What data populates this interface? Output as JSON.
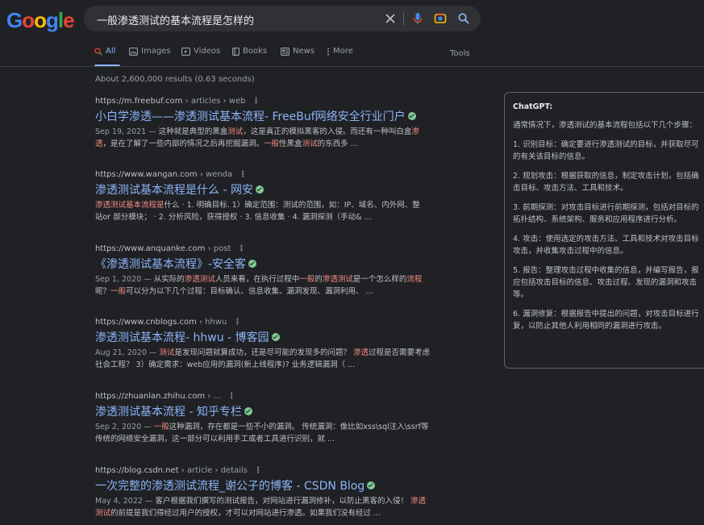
{
  "logo": {
    "letters": [
      "G",
      "o",
      "o",
      "g",
      "l",
      "e"
    ],
    "colors": [
      "#4285f4",
      "#ea4335",
      "#fbbc05",
      "#4285f4",
      "#34a853",
      "#ea4335"
    ]
  },
  "search": {
    "query": "一般渗透测试的基本流程是怎样的"
  },
  "tabs": [
    {
      "label": "All",
      "icon": "search-icon"
    },
    {
      "label": "Images",
      "icon": "image-icon"
    },
    {
      "label": "Videos",
      "icon": "play-icon"
    },
    {
      "label": "Books",
      "icon": "book-icon"
    },
    {
      "label": "News",
      "icon": "news-icon"
    },
    {
      "label": "More",
      "icon": "more-vert-icon"
    }
  ],
  "tools_label": "Tools",
  "stats": "About 2,600,000 results (0.63 seconds)",
  "results": [
    {
      "domain": "https://m.freebuf.com",
      "path": " › articles › web",
      "title": "小白学渗透——渗透测试基本流程- FreeBuf网络安全行业门户",
      "date": "Sep 19, 2021 — ",
      "s1": "这种就是典型的黑盒",
      "h1": "测试",
      "s2": "，这是真正的模拟黑客的入侵。而还有一种叫白盒",
      "h2": "渗",
      "s3": "透",
      "s4": "，是在了解了一些内部的情况之后再挖掘漏洞。",
      "h3": "一般",
      "s5": "性黑盒",
      "h4": "测试",
      "s6": "的东西多 ..."
    },
    {
      "domain": "https://www.wangan.com",
      "path": " › wenda",
      "title": "渗透测试基本流程是什么 - 网安",
      "h1": "渗透测试基本流程是",
      "s1": "什么 · 1. 明确目标. 1）确定范围：测试的范围，如：IP、域名、内外网、整",
      "s2": "站or 部分模块； · 2. 分析风险，获得授权 · 3. 信息收集 · 4. 漏洞探测（手动& ..."
    },
    {
      "domain": "https://www.anquanke.com",
      "path": " › post",
      "title": "《渗透测试基本流程》-安全客",
      "date": "Sep 1, 2020 — ",
      "s1": "从实际的",
      "h1": "渗透测试",
      "s2": "人员来看，在执行过程中",
      "h2": "一般",
      "s3": "的",
      "h3": "渗透测试",
      "s4": "是一个怎么样的",
      "h4": "流程",
      "s5": "呢？",
      "h5": "一般",
      "s6": "可以分为以下几个过程：目标确认、信息收集、漏洞发现、漏洞利用、 ..."
    },
    {
      "domain": "https://www.cnblogs.com",
      "path": " › hhwu",
      "title": "渗透测试基本流程- hhwu - 博客园",
      "date": "Aug 21, 2020 — ",
      "h1": "测试",
      "s1": "是发现问题就算成功，还是尽可能的发现多的问题？ ",
      "h2": "渗透",
      "s2": "过程是否需要考虑",
      "s3": "社会工程？ 3）确定需求：web应用的漏洞(新上线程序)? 业务逻辑漏洞（ ..."
    },
    {
      "domain": "https://zhuanlan.zhihu.com",
      "path": " › ...",
      "title": "渗透测试基本流程 - 知乎专栏",
      "date": "Sep 2, 2020 — ",
      "h1": "一般",
      "s1": "这种漏洞，存在都是一些不小的漏洞。 传统漏洞：像比如xss\\sql注入\\ssrf等",
      "s2": "传统的网络安全漏洞，这一部分可以利用手工或者工具进行识别，就 ..."
    },
    {
      "domain": "https://blog.csdn.net",
      "path": " › article › details",
      "title": "一次完整的渗透测试流程_谢公子的博客 - CSDN Blog",
      "date": "May 4, 2022 — ",
      "s1": "客户根据我们撰写的测试报告，对网站进行漏洞修补，以防止黑客的入侵！ ",
      "h1": "渗透",
      "h2": "测试",
      "s2": "的前提是我们得经过用户的授权，才可以对网站进行渗透。如果我们没有经过 ..."
    }
  ],
  "gpt": {
    "title": "ChatGPT:",
    "intro": "通常情况下，渗透测试的基本流程包括以下几个步骤：",
    "steps": [
      "1. 识别目标：确定要进行渗透测试的目标，并获取尽可\n的有关该目标的信息。",
      "2. 规划攻击：根据获取的信息，制定攻击计划，包括确\n击目标、攻击方法、工具和技术。",
      "3. 前期探测：对攻击目标进行前期探测，包括对目标的\n拓扑结构、系统架构、服务和应用程序进行分析。",
      "4. 攻击：使用选定的攻击方法、工具和技术对攻击目标\n攻击，并收集攻击过程中的信息。",
      "5. 报告：整理攻击过程中收集的信息，并编写报告，报\n应包括攻击目标的信息、攻击过程、发现的漏洞和攻击\n等。",
      "6. 漏洞修复：根据报告中提出的问题，对攻击目标进行\n复，以防止其他人利用相同的漏洞进行攻击。"
    ]
  }
}
